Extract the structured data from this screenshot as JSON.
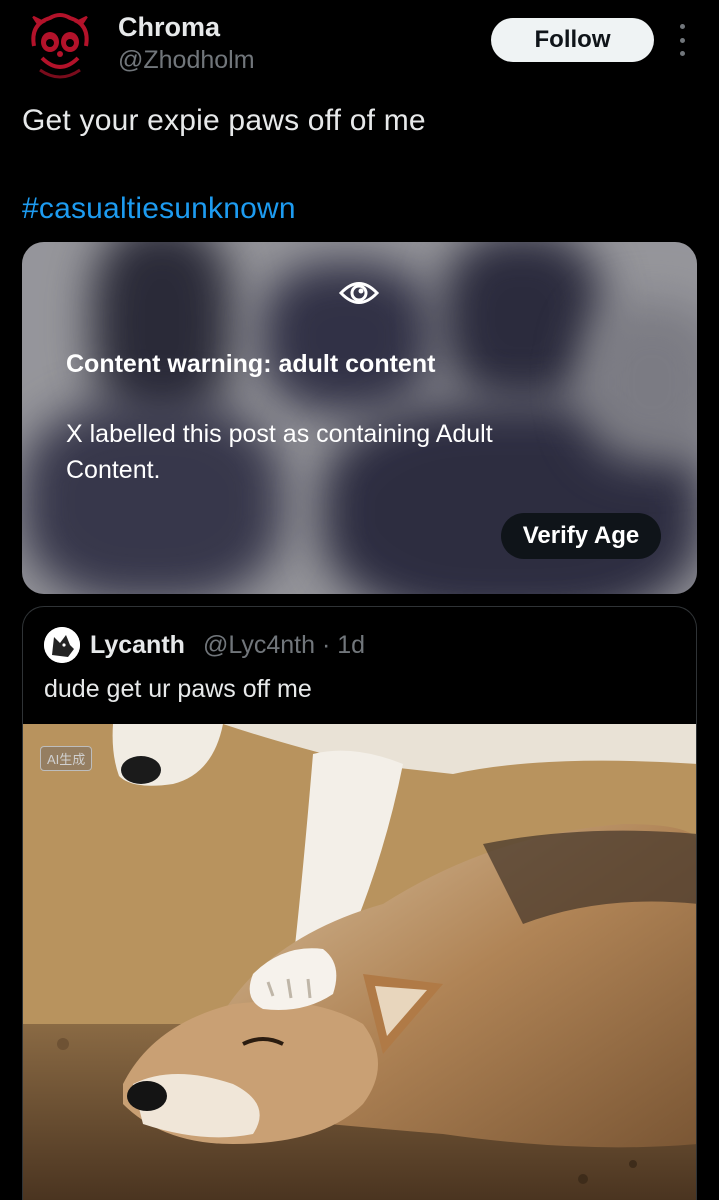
{
  "author": {
    "display_name": "Chroma",
    "handle": "@Zhodholm",
    "avatar_icon": "red-cartoon-face-avatar"
  },
  "header": {
    "follow_label": "Follow",
    "more_icon": "more-vertical-icon"
  },
  "post": {
    "text": "Get your expie paws off of me",
    "hashtag": "#casualtiesunknown"
  },
  "content_warning": {
    "icon": "eye-icon",
    "title": "Content warning: adult content",
    "description": "X labelled this post as containing Adult Content.",
    "verify_label": "Verify Age"
  },
  "quoted_post": {
    "display_name": "Lycanth",
    "meta": "@Lyc4nth · 1d",
    "text": "dude get ur paws off me",
    "avatar_icon": "wolf-avatar",
    "image": {
      "badge": "AI生成",
      "subject": "wolf-paw-on-wolf-head-photo"
    }
  },
  "colors": {
    "background": "#000000",
    "link": "#1d9bf0",
    "secondary_text": "#71767b",
    "follow_bg": "#eff3f4"
  }
}
